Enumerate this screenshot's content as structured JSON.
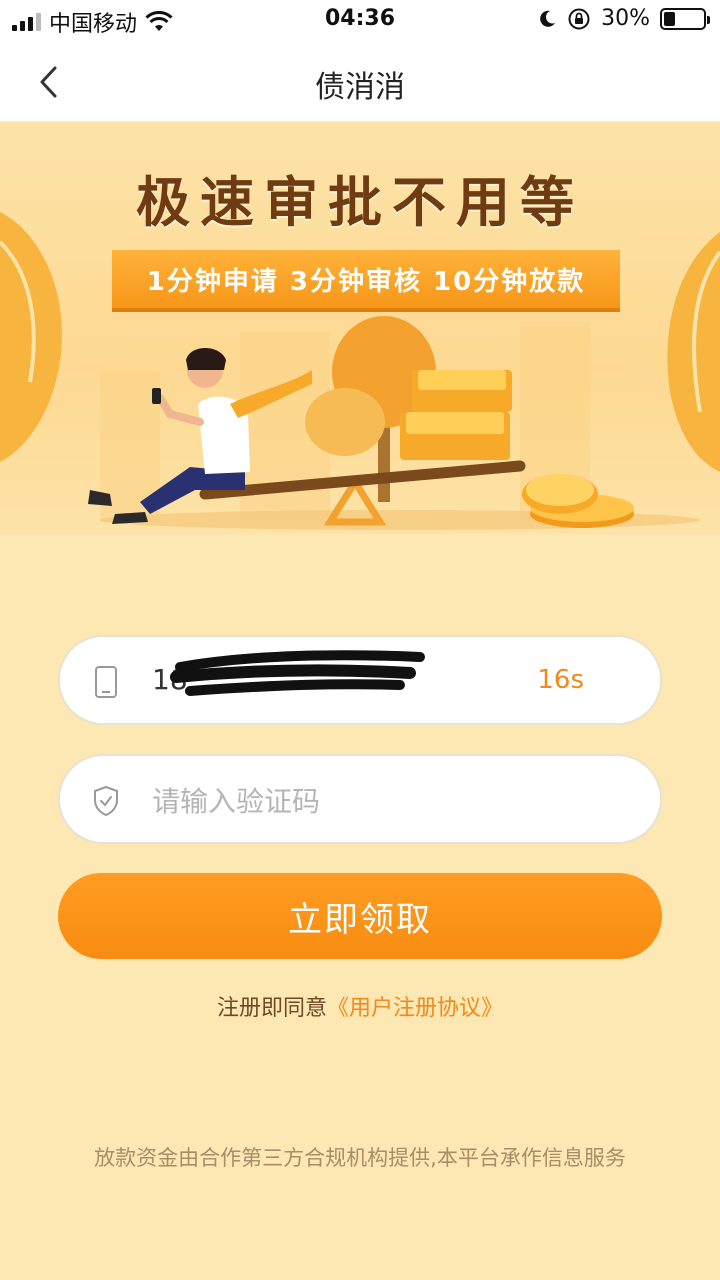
{
  "status_bar": {
    "carrier": "中国移动",
    "time": "04:36",
    "battery_percent": "30%",
    "battery_level": 0.3
  },
  "nav": {
    "title": "债消消",
    "back_icon": "chevron-left-icon"
  },
  "banner": {
    "headline": "极速审批不用等",
    "ribbon": "1分钟申请 3分钟审核 10分钟放款"
  },
  "form": {
    "phone_value": "18",
    "countdown": "16s",
    "code_placeholder": "请输入验证码",
    "submit_label": "立即领取"
  },
  "agreement": {
    "prefix": "注册即同意",
    "link": "《用户注册协议》"
  },
  "footer": {
    "note": "放款资金由合作第三方合规机构提供,本平台承作信息服务"
  },
  "colors": {
    "accent": "#f88c12",
    "background": "#fde7b3",
    "headline": "#6e3b12"
  }
}
